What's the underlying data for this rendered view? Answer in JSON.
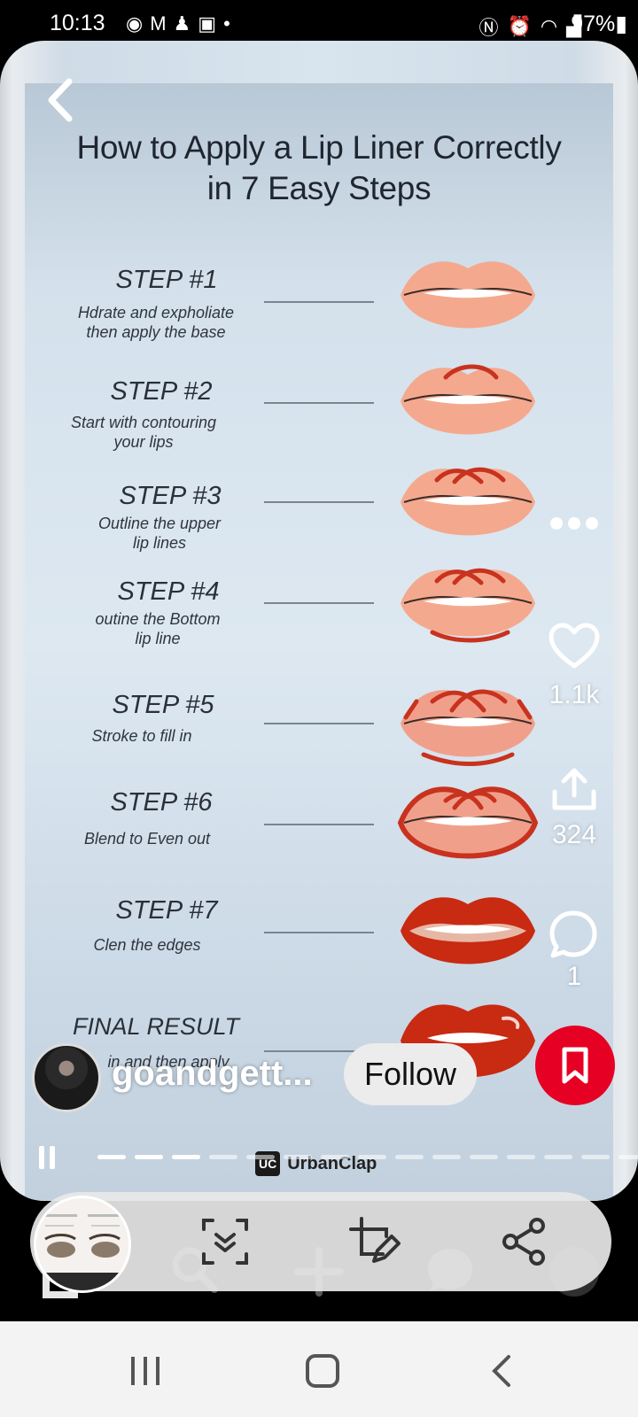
{
  "status_bar": {
    "time": "10:13",
    "battery": "97%",
    "notification_icons": [
      "messenger-icon",
      "gmail-icon",
      "person-add-icon",
      "photo-icon",
      "dot-icon"
    ],
    "system_icons": [
      "nfc-icon",
      "alarm-icon",
      "wifi-icon",
      "signal-icon"
    ]
  },
  "pin": {
    "title_line1": "How to Apply a Lip Liner Correctly",
    "title_line2": "in 7 Easy Steps",
    "steps": [
      {
        "label": "STEP #1",
        "desc1": "Hdrate and expholiate",
        "desc2": "then apply the base"
      },
      {
        "label": "STEP #2",
        "desc1": "Start with contouring",
        "desc2": "your lips"
      },
      {
        "label": "STEP #3",
        "desc1": "Outline the upper",
        "desc2": "lip lines"
      },
      {
        "label": "STEP #4",
        "desc1": "outine the Bottom",
        "desc2": "lip line"
      },
      {
        "label": "STEP #5",
        "desc1": "Stroke to fill in",
        "desc2": ""
      },
      {
        "label": "STEP #6",
        "desc1": "Blend to Even out",
        "desc2": ""
      },
      {
        "label": "STEP #7",
        "desc1": "Clen the edges",
        "desc2": ""
      },
      {
        "label": "FINAL RESULT",
        "desc1": "in and then apply",
        "desc2": ""
      }
    ],
    "brand_badge": "UC",
    "brand_name": "UrbanClap"
  },
  "actions": {
    "likes": "1.1k",
    "shares": "324",
    "comments": "1"
  },
  "creator": {
    "username": "goandgett...",
    "follow_label": "Follow"
  },
  "player": {
    "segments_total": 15,
    "segments_active": 3
  },
  "colors": {
    "save_red": "#e60023",
    "lip_light": "#f4a98e",
    "lip_liner": "#c8321e",
    "lip_final": "#c92a12"
  }
}
